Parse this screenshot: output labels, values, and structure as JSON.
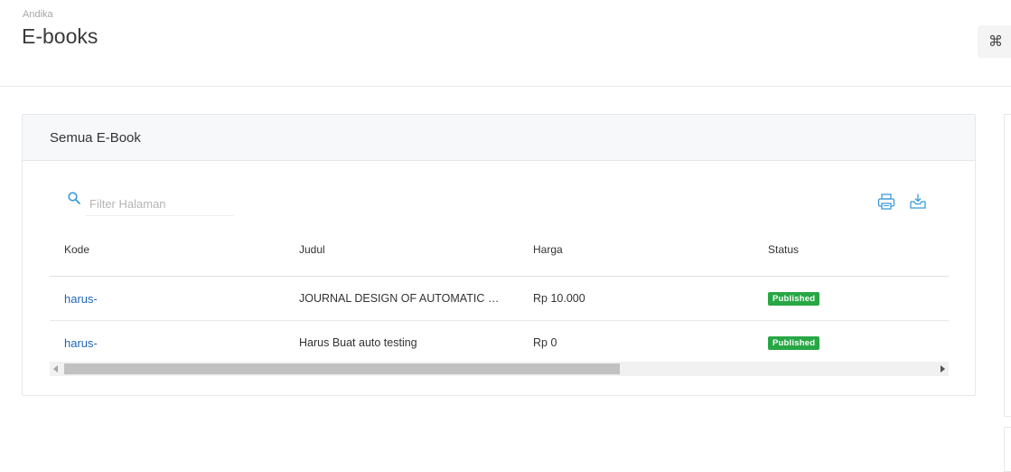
{
  "header": {
    "breadcrumb": "Andika",
    "title": "E-books",
    "command_icon": "⌘"
  },
  "card": {
    "title": "Semua E-Book",
    "search": {
      "placeholder": "Filter Halaman",
      "value": ""
    },
    "tools": {
      "print_icon": "printer-icon",
      "download_icon": "download-tray-icon"
    },
    "table": {
      "columns": [
        "Kode",
        "Judul",
        "Harga",
        "Status"
      ],
      "rows": [
        {
          "kode": "harus-",
          "judul": "JOURNAL DESIGN OF AUTOMATIC DOOR",
          "harga": "Rp 10.000",
          "status": "Published"
        },
        {
          "kode": "harus-",
          "judul": "Harus Buat auto testing",
          "harga": "Rp 0",
          "status": "Published"
        }
      ]
    }
  },
  "colors": {
    "link": "#1f66b8",
    "badge_success": "#28a745",
    "icon_accent": "#3b9ad9"
  }
}
